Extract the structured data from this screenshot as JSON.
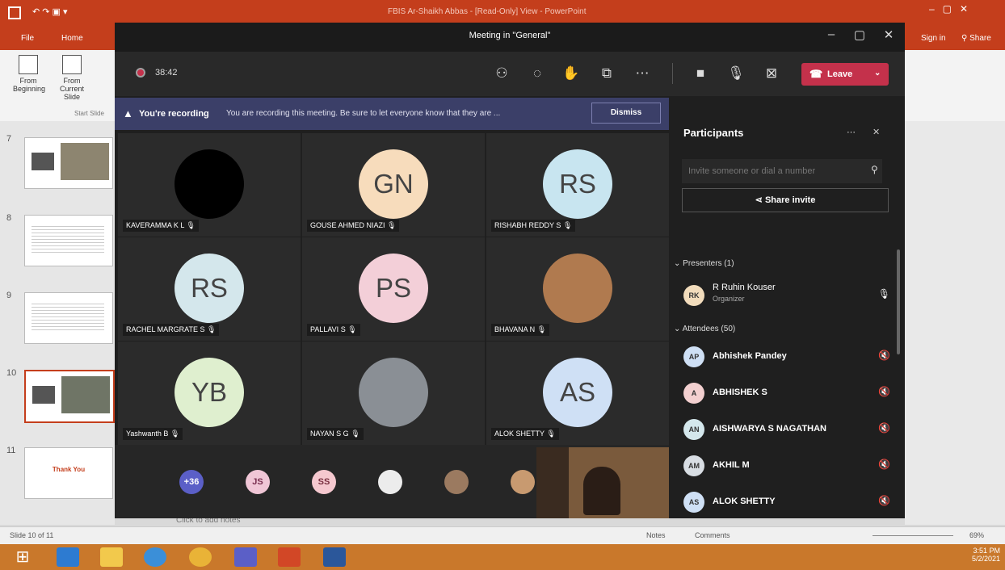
{
  "ppt": {
    "title": "FBIS Ar-Shaikh Abbas - [Read-Only] View - PowerPoint",
    "tabs": [
      "File",
      "Home"
    ],
    "right_tabs": [
      "Sign in",
      "Share"
    ],
    "ribbon": {
      "from_beginning": "From Beginning",
      "from_current": "From Current Slide",
      "group": "Start Slide"
    },
    "slides": [
      "7",
      "8",
      "9",
      "10",
      "11"
    ],
    "thumb_label": "Thank You",
    "status_left": "Slide 10 of 11",
    "notes_hint": "Click to add notes",
    "status_right": [
      "Notes",
      "Comments"
    ],
    "zoom": "69%"
  },
  "taskbar": {
    "time": "3:51 PM",
    "date": "5/2/2021"
  },
  "teams": {
    "window_title": "Meeting in \"General\"",
    "timer": "38:42",
    "leave_label": "Leave",
    "banner": {
      "bold": "You're recording",
      "text": "You are recording this meeting. Be sure to let everyone know that they are ...",
      "dismiss": "Dismiss"
    },
    "tiles": [
      {
        "name": "KAVERAMMA K L",
        "initials": "",
        "color": "#000000"
      },
      {
        "name": "GOUSE AHMED NIAZI",
        "initials": "GN",
        "color": "#f7dcbc"
      },
      {
        "name": "RISHABH REDDY S",
        "initials": "RS",
        "color": "#c8e5f0"
      },
      {
        "name": "RACHEL MARGRATE S",
        "initials": "RS",
        "color": "#d4e7ec"
      },
      {
        "name": "PALLAVI S",
        "initials": "PS",
        "color": "#f3cfd8"
      },
      {
        "name": "BHAVANA N",
        "initials": "",
        "color": "#b07a4f"
      },
      {
        "name": "Yashwanth B",
        "initials": "YB",
        "color": "#dfefcf"
      },
      {
        "name": "NAYAN S G",
        "initials": "",
        "color": "#8a8f95"
      },
      {
        "name": "ALOK SHETTY",
        "initials": "AS",
        "color": "#cfe0f5"
      }
    ],
    "strip": [
      {
        "label": "+36",
        "color": "#5b5fc7",
        "text_color": "#ffffff"
      },
      {
        "label": "JS",
        "color": "#f0c6d6",
        "text_color": "#7a3050"
      },
      {
        "label": "SS",
        "color": "#f5c8cf",
        "text_color": "#7a3040"
      },
      {
        "label": "",
        "color": "#ececec",
        "text_color": "#333333"
      },
      {
        "label": "",
        "color": "#9b7a60",
        "text_color": "#ffffff"
      },
      {
        "label": "",
        "color": "#c89a70",
        "text_color": "#ffffff"
      }
    ]
  },
  "panel": {
    "title": "Participants",
    "invite_placeholder": "Invite someone or dial a number",
    "share_invite": "Share invite",
    "presenters_label": "Presenters (1)",
    "presenter": {
      "name": "R Ruhin Kouser",
      "role": "Organizer",
      "initials": "RK"
    },
    "attendees_label": "Attendees (50)",
    "attendees": [
      {
        "name": "Abhishek Pandey",
        "initials": "AP",
        "color": "#cfe0f5"
      },
      {
        "name": "ABHISHEK S",
        "initials": "A",
        "color": "#f3d0d0"
      },
      {
        "name": "AISHWARYA S NAGATHAN",
        "initials": "AN",
        "color": "#d4e7ec"
      },
      {
        "name": "AKHIL M",
        "initials": "AM",
        "color": "#d8dde3"
      },
      {
        "name": "ALOK SHETTY",
        "initials": "AS",
        "color": "#cfe0f5"
      }
    ]
  }
}
